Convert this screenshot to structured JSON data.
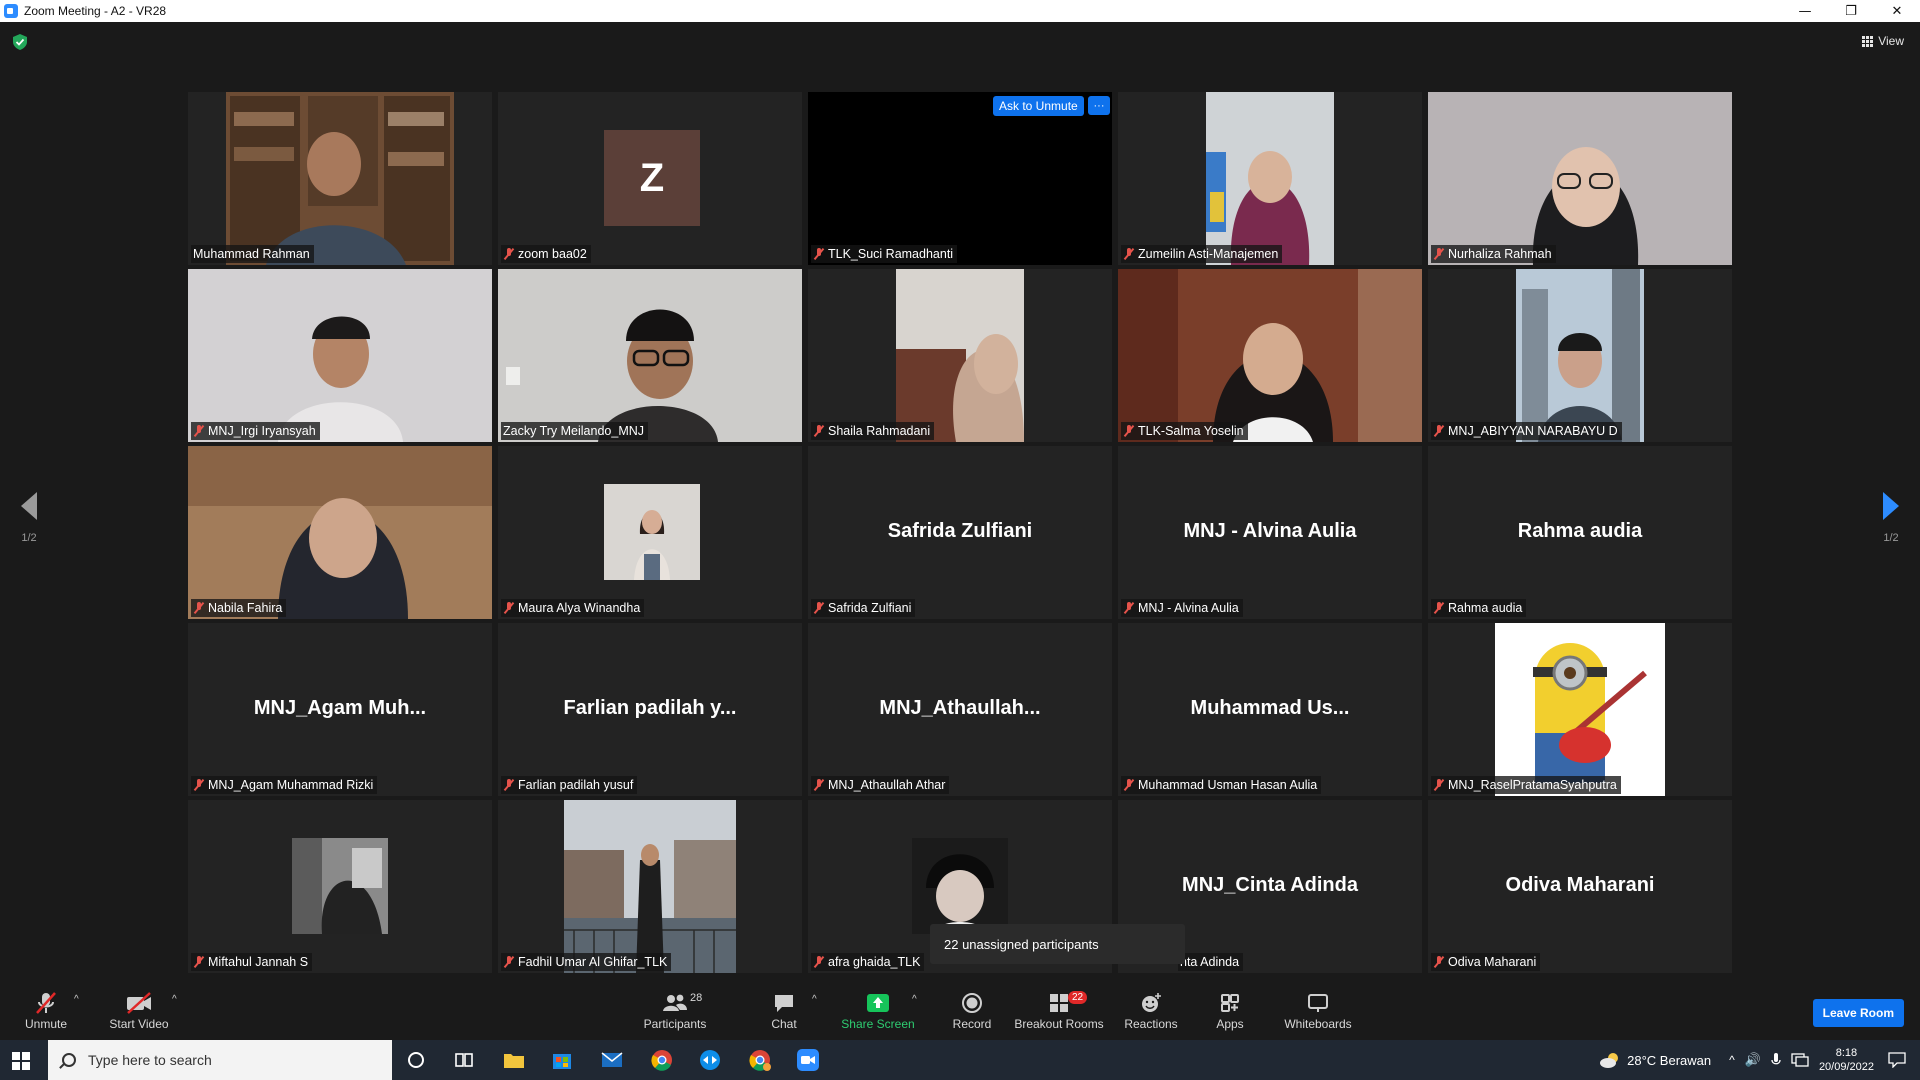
{
  "window": {
    "title": "Zoom Meeting - A2 - VR28"
  },
  "top": {
    "view_label": "View"
  },
  "pager": {
    "left": "1/2",
    "right": "1/2"
  },
  "tiles": [
    {
      "name": "Muhammad Rahman",
      "muted": false,
      "kind": "video"
    },
    {
      "name": "zoom baa02",
      "muted": true,
      "kind": "avatar",
      "initial": "Z"
    },
    {
      "name": "TLK_Suci Ramadhanti",
      "muted": true,
      "kind": "black",
      "ask_unmute": "Ask to Unmute",
      "more": "···"
    },
    {
      "name": "Zumeilin Asti-Manajemen",
      "muted": true,
      "kind": "video"
    },
    {
      "name": "Nurhaliza Rahmah",
      "muted": true,
      "kind": "video"
    },
    {
      "name": "MNJ_Irgi Iryansyah",
      "muted": true,
      "kind": "video"
    },
    {
      "name": "Zacky Try Meilando_MNJ",
      "muted": false,
      "kind": "video",
      "active": true
    },
    {
      "name": "Shaila Rahmadani",
      "muted": true,
      "kind": "video"
    },
    {
      "name": "TLK-Salma Yoselin",
      "muted": true,
      "kind": "video"
    },
    {
      "name": "MNJ_ABIYYAN NARABAYU D",
      "muted": true,
      "kind": "video"
    },
    {
      "name": "Nabila Fahira",
      "muted": true,
      "kind": "video"
    },
    {
      "name": "Maura Alya Winandha",
      "muted": true,
      "kind": "photo"
    },
    {
      "name": "Safrida Zulfiani",
      "muted": true,
      "kind": "text",
      "display": "Safrida Zulfiani"
    },
    {
      "name": "MNJ - Alvina Aulia",
      "muted": true,
      "kind": "text",
      "display": "MNJ - Alvina Aulia"
    },
    {
      "name": "Rahma audia",
      "muted": true,
      "kind": "text",
      "display": "Rahma audia"
    },
    {
      "name": "MNJ_Agam Muhammad Rizki",
      "muted": true,
      "kind": "text",
      "display": "MNJ_Agam  Muh..."
    },
    {
      "name": "Farlian padilah yusuf",
      "muted": true,
      "kind": "text",
      "display": "Farlian  padilah  y..."
    },
    {
      "name": "MNJ_Athaullah Athar",
      "muted": true,
      "kind": "text",
      "display": "MNJ_Athaullah..."
    },
    {
      "name": "Muhammad Usman Hasan Aulia",
      "muted": true,
      "kind": "text",
      "display": "Muhammad  Us..."
    },
    {
      "name": "MNJ_RaselPratamaSyahputra",
      "muted": true,
      "kind": "photo"
    },
    {
      "name": "Miftahul Jannah S",
      "muted": true,
      "kind": "photo"
    },
    {
      "name": "Fadhil Umar Al Ghifar_TLK",
      "muted": true,
      "kind": "photo"
    },
    {
      "name": "afra ghaida_TLK",
      "muted": true,
      "kind": "photo"
    },
    {
      "name": "nta Adinda",
      "muted": false,
      "kind": "text",
      "display": "MNJ_Cinta Adinda"
    },
    {
      "name": "Odiva Maharani",
      "muted": true,
      "kind": "text",
      "display": "Odiva Maharani"
    }
  ],
  "tooltip": "22 unassigned participants",
  "toolbar": {
    "unmute": "Unmute",
    "start_video": "Start Video",
    "participants": "Participants",
    "participants_count": "28",
    "chat": "Chat",
    "share_screen": "Share Screen",
    "record": "Record",
    "breakout_rooms": "Breakout Rooms",
    "breakout_badge": "22",
    "reactions": "Reactions",
    "apps": "Apps",
    "whiteboards": "Whiteboards",
    "leave": "Leave Room"
  },
  "taskbar": {
    "search_placeholder": "Type here to search",
    "weather": "28°C  Berawan",
    "time": "8:18",
    "date": "20/09/2022"
  },
  "colors": {
    "accent": "#0e72ed",
    "active_speaker": "#d7ec5c",
    "muted_icon": "#e5534b",
    "share_green": "#16c45a"
  }
}
